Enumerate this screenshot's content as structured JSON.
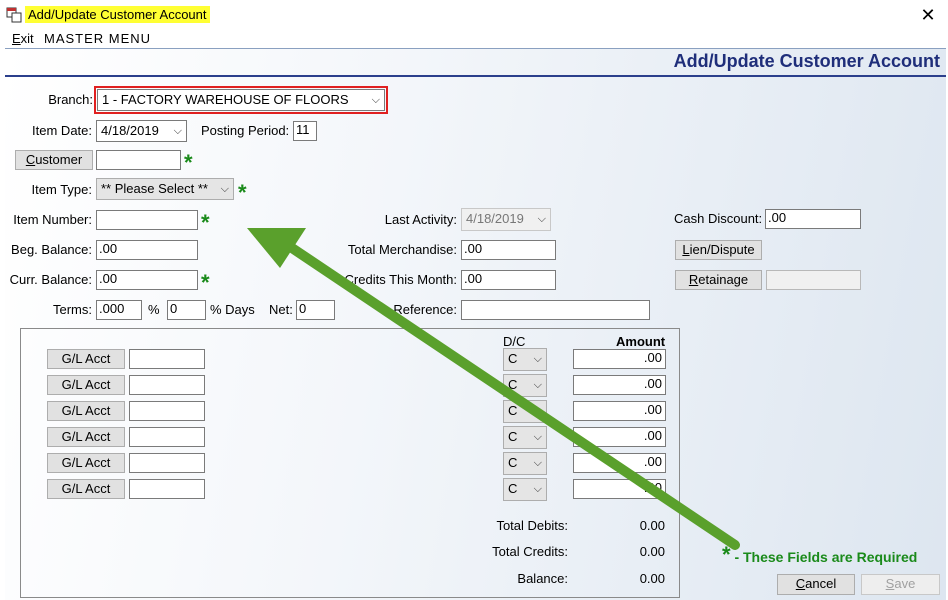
{
  "window": {
    "title": "Add/Update Customer Account",
    "close_glyph": "✕"
  },
  "menu": {
    "exit_hotkey": "E",
    "exit_rest": "xit",
    "master_menu": "M A S T E R   M E N U"
  },
  "header": {
    "title": "Add/Update Customer Account"
  },
  "form": {
    "branch_label": "Branch:",
    "branch_value": "1  - FACTORY WAREHOUSE OF FLOORS",
    "item_date_label": "Item Date:",
    "item_date_value": "4/18/2019",
    "posting_period_label": "Posting Period:",
    "posting_period_value": "11",
    "customer_button_hotkey": "C",
    "customer_button_rest": "ustomer",
    "customer_value": "",
    "item_type_label": "Item Type:",
    "item_type_value": "** Please Select **",
    "item_number_label": "Item Number:",
    "item_number_value": "",
    "beg_balance_label": "Beg. Balance:",
    "beg_balance_value": ".00",
    "curr_balance_label": "Curr. Balance:",
    "curr_balance_value": ".00",
    "terms_label": "Terms:",
    "terms_value": ".000",
    "percent_label": "%",
    "days_value": "0",
    "days_label": "% Days",
    "net_label": "Net:",
    "net_value": "0",
    "last_activity_label": "Last Activity:",
    "last_activity_value": "4/18/2019",
    "total_merch_label": "Total Merchandise:",
    "total_merch_value": ".00",
    "credits_month_label": "Credits This Month:",
    "credits_month_value": ".00",
    "reference_label": "Reference:",
    "reference_value": "",
    "cash_discount_label": "Cash Discount:",
    "cash_discount_value": ".00",
    "lien_button_hotkey": "L",
    "lien_button_rest": "ien/Dispute",
    "retainage_button_hotkey": "R",
    "retainage_button_rest": "etainage",
    "retainage_value": "",
    "required_star": "*"
  },
  "gl": {
    "dc_header": "D/C",
    "amount_header": "Amount",
    "rows": [
      {
        "button": "G/L Acct",
        "account": "",
        "dc": "C",
        "amount": ".00"
      },
      {
        "button": "G/L Acct",
        "account": "",
        "dc": "C",
        "amount": ".00"
      },
      {
        "button": "G/L Acct",
        "account": "",
        "dc": "C",
        "amount": ".00"
      },
      {
        "button": "G/L Acct",
        "account": "",
        "dc": "C",
        "amount": ".00"
      },
      {
        "button": "G/L Acct",
        "account": "",
        "dc": "C",
        "amount": ".00"
      },
      {
        "button": "G/L Acct",
        "account": "",
        "dc": "C",
        "amount": ".00"
      }
    ],
    "total_debits_label": "Total Debits:",
    "total_debits_value": "0.00",
    "total_credits_label": "Total Credits:",
    "total_credits_value": "0.00",
    "balance_label": "Balance:",
    "balance_value": "0.00"
  },
  "footer": {
    "required_note": " - These Fields are Required",
    "cancel_hotkey": "C",
    "cancel_rest": "ancel",
    "save_hotkey": "S",
    "save_rest": "ave"
  },
  "colors": {
    "header_text": "#1f2e7a",
    "required_green": "#1a8a1a",
    "arrow_green": "#5aa02c",
    "branch_highlight": "#e02020",
    "title_highlight": "#ffff33"
  }
}
